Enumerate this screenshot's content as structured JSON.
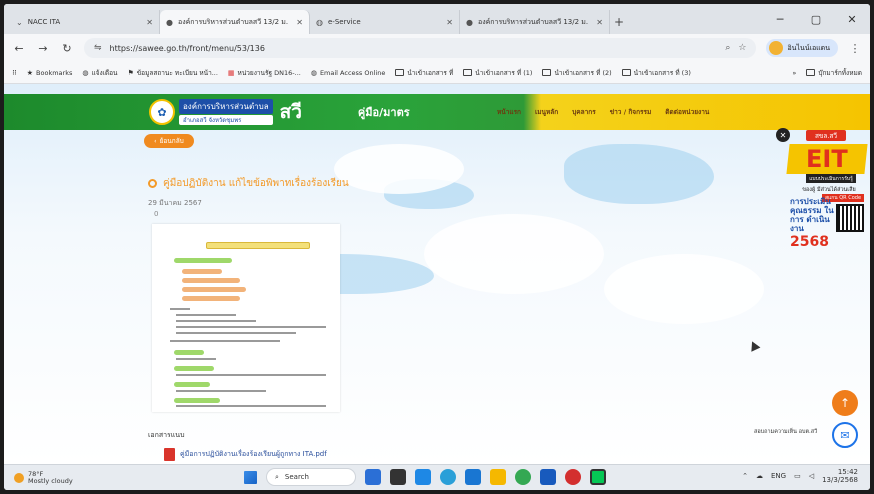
{
  "browser": {
    "tabs": [
      {
        "label": "NACC ITA",
        "active": false
      },
      {
        "label": "องค์การบริหารส่วนตำบลสวี 13/2 ม.",
        "active": true
      },
      {
        "label": "e-Service",
        "active": false
      },
      {
        "label": "องค์การบริหารส่วนตำบลสวี 13/2 ม.",
        "active": false
      }
    ],
    "url": "https://sawee.go.th/front/menu/53/136",
    "profile_label": "อินไนน์เอแดน",
    "bookmarks": [
      {
        "label": "Bookmarks",
        "icon": "star-icon"
      },
      {
        "label": "แจ้งเตือน",
        "icon": "globe-icon"
      },
      {
        "label": "ข้อมูลสถานะ ทะเบียน หน้า...",
        "icon": "flag-icon"
      },
      {
        "label": "หน่วยงานรัฐ DN16-...",
        "icon": "calendar-icon"
      },
      {
        "label": "Email Access Online",
        "icon": "globe-icon"
      },
      {
        "label": "นำเข้าเอกสาร ที่",
        "icon": "folder-icon"
      },
      {
        "label": "นำเข้าเอกสาร ที่ (1)",
        "icon": "folder-icon"
      },
      {
        "label": "นำเข้าเอกสาร ที่ (2)",
        "icon": "folder-icon"
      },
      {
        "label": "นำเข้าเอกสาร ที่ (3)",
        "icon": "folder-icon"
      },
      {
        "label": "บุ๊กมาร์กทั้งหมด",
        "icon": "folder-icon"
      }
    ]
  },
  "site": {
    "logo_line1": "องค์การบริหารส่วนตำบล",
    "logo_line2": "อำเภอสวี จังหวัดชุมพร",
    "logo_big": "สวี",
    "header_title": "คู่มือ/มาตร",
    "menu": [
      "หน้าแรก",
      "เมนูหลัก",
      "บุคลากร",
      "ข่าว / กิจกรรม",
      "ติดต่อหน่วยงาน"
    ],
    "back_label": "ย้อนกลับ",
    "page_title": "คู่มือปฏิบัติงาน แก้ไขข้อพิพาทเรื่องร้องเรียน",
    "page_date": "29 มีนาคม 2567",
    "views": "0",
    "docs_heading": "เอกสารแนบ",
    "doc_file": "คู่มือการปฏิบัติงานเรื่องร้องเรียนผู้ถูกทาง ITA.pdf",
    "eit": {
      "tag": "สขล.สวี",
      "big": "EIT",
      "sub": "แบบประเมินการรับรู้",
      "t1": "ของผู้ มีส่วนได้ส่วนเสีย",
      "t2": "การประเมิน คุณธรรม ในการ ดำเนินงาน",
      "scan": "สแกน QR Code",
      "year": "2568"
    },
    "opinion_label": "สอบถามความเห็น อบต.สวี"
  },
  "taskbar": {
    "temp": "78°F",
    "weather": "Mostly cloudy",
    "search_label": "Search",
    "lang": "ENG",
    "time": "15:42",
    "date": "13/3/2568"
  }
}
